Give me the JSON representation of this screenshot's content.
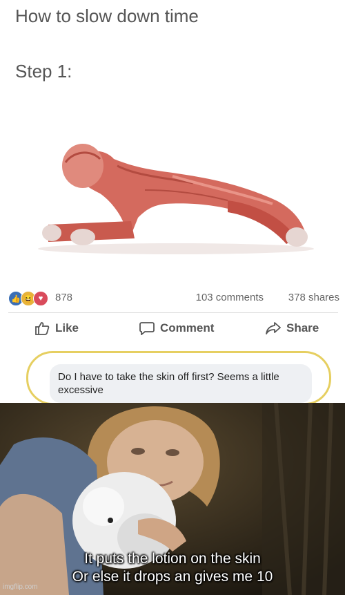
{
  "post": {
    "title": "How to slow down time",
    "step": "Step 1:",
    "reaction_count": "878",
    "comments": "103 comments",
    "shares": "378 shares",
    "actions": {
      "like": "Like",
      "comment": "Comment",
      "share": "Share"
    },
    "comment_text": "Do I have to take the skin off first? Seems a little excessive",
    "reaction_icons": [
      "like-icon",
      "haha-icon",
      "love-icon"
    ],
    "highlight_color": "#e6cf61"
  },
  "meme": {
    "caption_line1": "It puts the lotion on the skin",
    "caption_line2": "Or else it drops an gives me 10",
    "watermark": "imgflip.com"
  }
}
